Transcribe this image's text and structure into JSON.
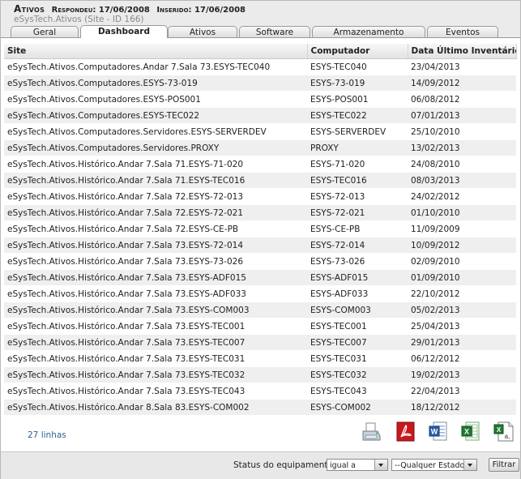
{
  "header": {
    "app_title": "Ativos",
    "responded_label": "Respondeu:",
    "responded_date": "17/06/2008",
    "inserted_label": "Inserido:",
    "inserted_date": "17/06/2008",
    "site_name": "eSysTech.Ativos",
    "site_id": "(Site - ID 166)"
  },
  "tabs": [
    {
      "label": "Geral",
      "active": false
    },
    {
      "label": "Dashboard",
      "active": true
    },
    {
      "label": "Ativos",
      "active": false
    },
    {
      "label": "Software",
      "active": false
    },
    {
      "label": "Armazenamento",
      "active": false
    },
    {
      "label": "Eventos",
      "active": false
    }
  ],
  "table": {
    "columns": [
      "Site",
      "Computador",
      "Data Último Inventário"
    ],
    "rows": [
      [
        "eSysTech.Ativos.Computadores.Andar 7.Sala 73.ESYS-TEC040",
        "ESYS-TEC040",
        "23/04/2013"
      ],
      [
        "eSysTech.Ativos.Computadores.ESYS-73-019",
        "ESYS-73-019",
        "14/09/2012"
      ],
      [
        "eSysTech.Ativos.Computadores.ESYS-POS001",
        "ESYS-POS001",
        "06/08/2012"
      ],
      [
        "eSysTech.Ativos.Computadores.ESYS-TEC022",
        "ESYS-TEC022",
        "07/01/2013"
      ],
      [
        "eSysTech.Ativos.Computadores.Servidores.ESYS-SERVERDEV",
        "ESYS-SERVERDEV",
        "25/10/2010"
      ],
      [
        "eSysTech.Ativos.Computadores.Servidores.PROXY",
        "PROXY",
        "13/02/2013"
      ],
      [
        "eSysTech.Ativos.Histórico.Andar 7.Sala 71.ESYS-71-020",
        "ESYS-71-020",
        "24/08/2010"
      ],
      [
        "eSysTech.Ativos.Histórico.Andar 7.Sala 71.ESYS-TEC016",
        "ESYS-TEC016",
        "08/03/2013"
      ],
      [
        "eSysTech.Ativos.Histórico.Andar 7.Sala 72.ESYS-72-013",
        "ESYS-72-013",
        "24/02/2012"
      ],
      [
        "eSysTech.Ativos.Histórico.Andar 7.Sala 72.ESYS-72-021",
        "ESYS-72-021",
        "01/10/2010"
      ],
      [
        "eSysTech.Ativos.Histórico.Andar 7.Sala 72.ESYS-CE-PB",
        "ESYS-CE-PB",
        "11/09/2009"
      ],
      [
        "eSysTech.Ativos.Histórico.Andar 7.Sala 73.ESYS-72-014",
        "ESYS-72-014",
        "10/09/2012"
      ],
      [
        "eSysTech.Ativos.Histórico.Andar 7.Sala 73.ESYS-73-026",
        "ESYS-73-026",
        "02/09/2010"
      ],
      [
        "eSysTech.Ativos.Histórico.Andar 7.Sala 73.ESYS-ADF015",
        "ESYS-ADF015",
        "01/09/2010"
      ],
      [
        "eSysTech.Ativos.Histórico.Andar 7.Sala 73.ESYS-ADF033",
        "ESYS-ADF033",
        "22/10/2012"
      ],
      [
        "eSysTech.Ativos.Histórico.Andar 7.Sala 73.ESYS-COM003",
        "ESYS-COM003",
        "05/02/2013"
      ],
      [
        "eSysTech.Ativos.Histórico.Andar 7.Sala 73.ESYS-TEC001",
        "ESYS-TEC001",
        "25/04/2013"
      ],
      [
        "eSysTech.Ativos.Histórico.Andar 7.Sala 73.ESYS-TEC007",
        "ESYS-TEC007",
        "29/01/2013"
      ],
      [
        "eSysTech.Ativos.Histórico.Andar 7.Sala 73.ESYS-TEC031",
        "ESYS-TEC031",
        "06/12/2012"
      ],
      [
        "eSysTech.Ativos.Histórico.Andar 7.Sala 73.ESYS-TEC032",
        "ESYS-TEC032",
        "19/02/2013"
      ],
      [
        "eSysTech.Ativos.Histórico.Andar 7.Sala 73.ESYS-TEC043",
        "ESYS-TEC043",
        "22/04/2013"
      ],
      [
        "eSysTech.Ativos.Histórico.Andar 8.Sala 83.ESYS-COM002",
        "ESYS-COM002",
        "18/12/2012"
      ]
    ]
  },
  "footer": {
    "row_count": "27 linhas",
    "export_icons": [
      "printer-icon",
      "pdf-icon",
      "word-icon",
      "excel-icon",
      "excel-csv-icon"
    ]
  },
  "status_filter": {
    "label": "Status do equipamento",
    "operator_value": "igual a",
    "state_value": "--Qualquer Estado--",
    "button_label": "Filtrar"
  },
  "colors": {
    "header_bg": "#ebebeb",
    "row_alt": "#efefef",
    "count_link": "#2f5f8f"
  }
}
